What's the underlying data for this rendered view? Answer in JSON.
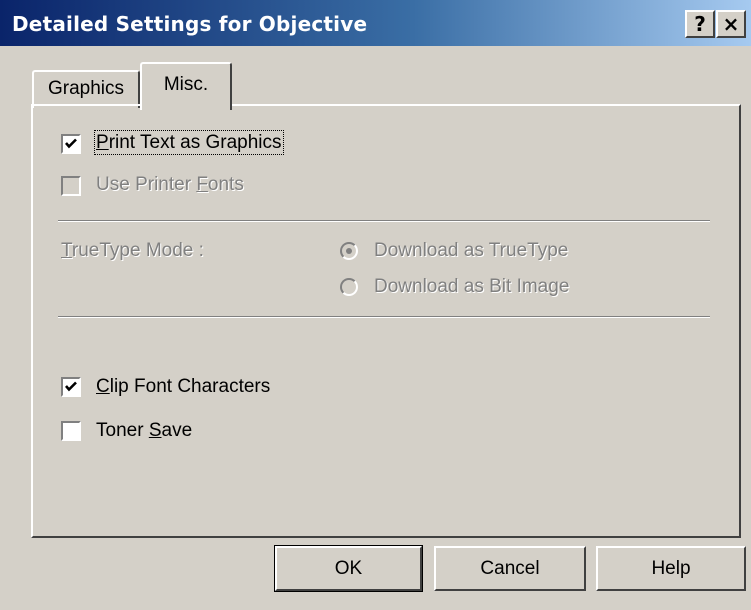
{
  "window": {
    "title": "Detailed Settings for Objective",
    "help_button": "?",
    "close_button": "×"
  },
  "tabs": [
    {
      "label": "Graphics",
      "selected": false
    },
    {
      "label": "Misc.",
      "selected": true
    }
  ],
  "misc": {
    "print_text_as_graphics": {
      "pre": "",
      "key": "P",
      "post": "rint Text as Graphics",
      "checked": true,
      "enabled": true
    },
    "use_printer_fonts": {
      "pre": "Use Printer ",
      "key": "F",
      "post": "onts",
      "checked": false,
      "enabled": false
    },
    "truetype_mode": {
      "label_key": "T",
      "label_post": "rueType Mode :",
      "options": [
        {
          "label": "Download as TrueType",
          "selected": true,
          "enabled": false
        },
        {
          "label": "Download as Bit Image",
          "selected": false,
          "enabled": false
        }
      ]
    },
    "clip_font_characters": {
      "pre": "",
      "key": "C",
      "post": "lip Font Characters",
      "checked": true,
      "enabled": true
    },
    "toner_save": {
      "pre": "Toner ",
      "key": "S",
      "post": "ave",
      "checked": false,
      "enabled": true
    }
  },
  "buttons": {
    "ok": "OK",
    "cancel": "Cancel",
    "help": "Help"
  },
  "colors": {
    "dialog_bg": "#d4d0c8",
    "title_start": "#0a246a",
    "title_end": "#a6caf0",
    "disabled_text": "#808080"
  }
}
